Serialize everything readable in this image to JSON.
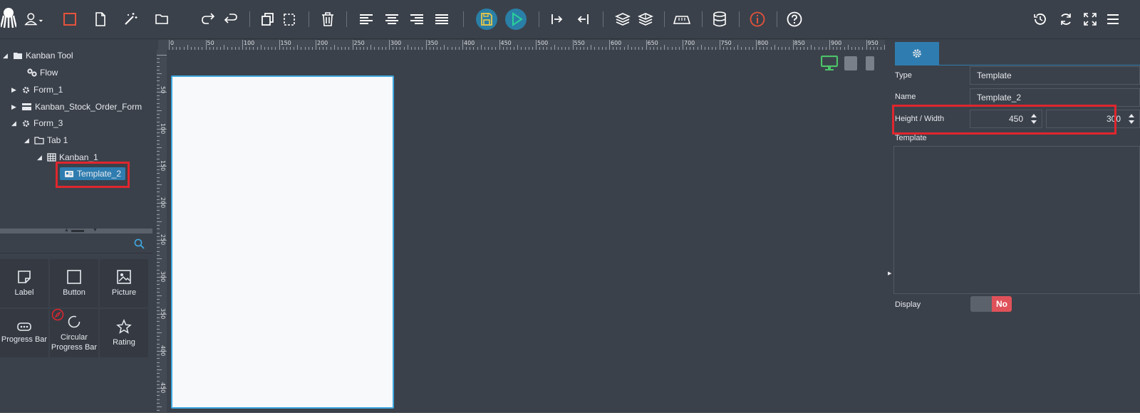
{
  "toolbar": {
    "buttons": [
      "octopus-logo-icon",
      "user-icon",
      "square-icon",
      "page-icon",
      "magic-wand-icon",
      "folder-icon",
      "redo-icon",
      "undo-icon",
      "copy-icon",
      "paste-icon",
      "trash-icon",
      "align-left-icon",
      "align-center-icon",
      "align-right-icon",
      "align-justify-icon",
      "save-icon",
      "play-icon",
      "indent-icon",
      "outdent-icon",
      "layers-icon",
      "layers-alt-icon",
      "ruler-icon",
      "database-icon",
      "info-icon",
      "help-icon",
      "history-icon",
      "refresh-icon",
      "fullscreen-icon",
      "menu-icon"
    ]
  },
  "tree": {
    "items": [
      {
        "label": "Kanban Tool"
      },
      {
        "label": "Flow"
      },
      {
        "label": "Form_1"
      },
      {
        "label": "Kanban_Stock_Order_Form"
      },
      {
        "label": "Form_3"
      },
      {
        "label": "Tab 1"
      },
      {
        "label": "Kanban_1"
      },
      {
        "label": "Template_2"
      }
    ]
  },
  "search": {
    "placeholder": ""
  },
  "tools": [
    {
      "label": "Label"
    },
    {
      "label": "Button"
    },
    {
      "label": "Picture"
    },
    {
      "label": "Progress Bar"
    },
    {
      "label": "Circular Progress Bar"
    },
    {
      "label": "Rating"
    }
  ],
  "ruler": {
    "h_labels": [
      "0",
      "50",
      "100",
      "150",
      "200",
      "250",
      "300",
      "350",
      "400",
      "450",
      "500",
      "550",
      "600",
      "650",
      "700",
      "750",
      "800",
      "850",
      "900",
      "950"
    ],
    "v_labels": [
      "50",
      "100",
      "150",
      "200",
      "250",
      "300",
      "350",
      "400",
      "450"
    ]
  },
  "props": {
    "type_label": "Type",
    "type_value": "Template",
    "name_label": "Name",
    "name_value": "Template_2",
    "hw_label": "Height / Width",
    "height_value": "450",
    "width_value": "300",
    "template_label": "Template",
    "display_label": "Display",
    "display_value": "No"
  },
  "colors": {
    "background": "#3b414a",
    "accent": "#2f7db0",
    "highlight": "#e0262e",
    "toggle_no": "#e0525a",
    "save_button": "#e8c84a",
    "play_button": "#2aa39a"
  }
}
